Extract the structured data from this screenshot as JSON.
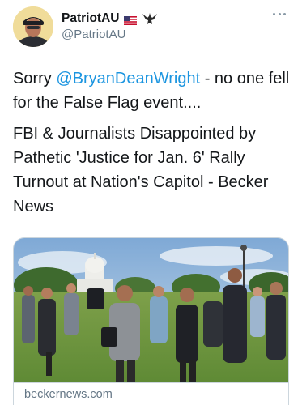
{
  "author": {
    "display_name": "PatriotAU",
    "handle": "@PatriotAU",
    "avatar_icon": "profile-photo",
    "badge_icons": [
      "us-flag-icon",
      "eagle-icon"
    ]
  },
  "menu_icon": "more-icon",
  "tweet": {
    "line1_prefix": "Sorry ",
    "mention": "@BryanDeanWright",
    "line1_suffix": " - no one fell for the False Flag event....",
    "headline": "FBI & Journalists Disappointed by Pathetic 'Justice for Jan. 6' Rally Turnout at Nation's Capitol - Becker News"
  },
  "link_card": {
    "domain": "beckernews.com",
    "image_subject": "photographers-at-capitol-photo"
  },
  "colors": {
    "text": "#14171a",
    "secondary": "#657786",
    "link": "#1b95e0",
    "border": "#ccd6dd"
  }
}
